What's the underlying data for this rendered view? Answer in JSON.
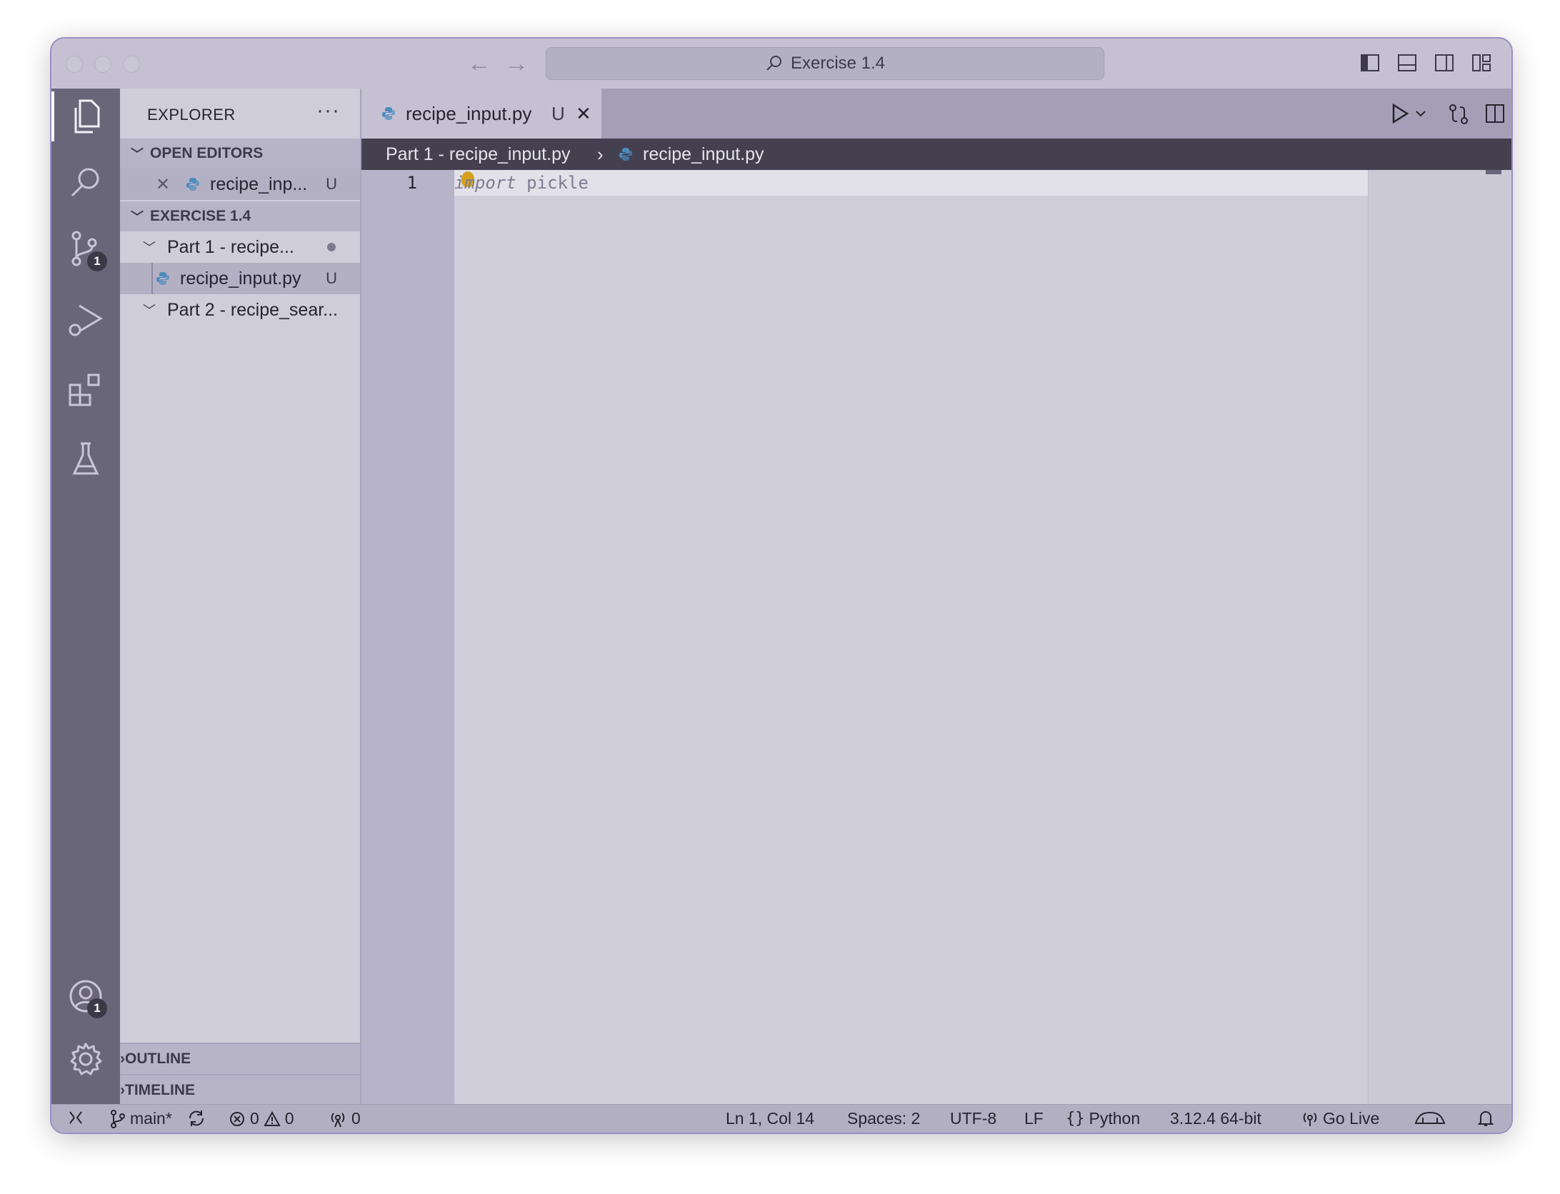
{
  "window": {
    "title": "Exercise 1.4"
  },
  "sidebar": {
    "title": "EXPLORER",
    "more": "···",
    "open_editors": {
      "header": "OPEN EDITORS",
      "items": [
        {
          "name": "recipe_inp...",
          "status": "U"
        }
      ]
    },
    "workspace": {
      "header": "EXERCISE 1.4",
      "folders": [
        {
          "name": "Part 1 - recipe..."
        },
        {
          "name": "Part 2 - recipe_sear..."
        }
      ],
      "files": [
        {
          "name": "recipe_input.py",
          "status": "U"
        }
      ]
    },
    "outline_header": "OUTLINE",
    "timeline_header": "TIMELINE"
  },
  "activity_bar": {
    "source_control_badge": "1",
    "accounts_badge": "1"
  },
  "editor": {
    "tab": {
      "label": "recipe_input.py",
      "status": "U"
    },
    "breadcrumb": {
      "folder": "Part 1 - recipe_input.py",
      "file": "recipe_input.py"
    },
    "lines": [
      {
        "number": "1",
        "keyword": "import",
        "text": " pickle"
      }
    ]
  },
  "statusbar": {
    "branch": "main*",
    "errors": "0",
    "warnings": "0",
    "ports": "0",
    "cursor": "Ln 1, Col 14",
    "spaces": "Spaces: 2",
    "encoding": "UTF-8",
    "eol": "LF",
    "language": "Python",
    "interpreter": "3.12.4 64-bit",
    "go_live": "Go Live"
  },
  "colors": {
    "activity_bar": "#6a6679",
    "sidebar": "#cfcdd9",
    "breadcrumb_bar": "#444050",
    "python_icon": "#4b8bbe"
  }
}
